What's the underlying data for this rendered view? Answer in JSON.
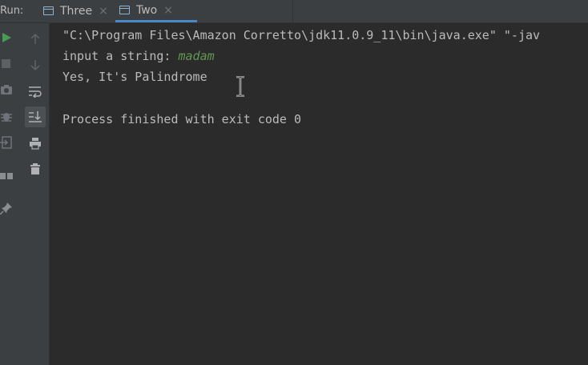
{
  "run_panel": {
    "label": "Run:",
    "tabs": [
      {
        "label": "Three",
        "close": "×",
        "active": false
      },
      {
        "label": "Two",
        "close": "×",
        "active": true
      }
    ]
  },
  "toolbar": {
    "outer": [
      {
        "icon": "rerun-icon",
        "color": "#499c54"
      },
      {
        "icon": "stop-icon"
      },
      {
        "icon": "camera-icon"
      },
      {
        "icon": "bug-icon"
      },
      {
        "icon": "exit-icon"
      },
      {
        "icon": "layout-icon"
      },
      {
        "icon": "pin-icon"
      }
    ],
    "inner": [
      {
        "icon": "up-arrow-icon"
      },
      {
        "icon": "down-arrow-icon"
      },
      {
        "icon": "soft-wrap-icon"
      },
      {
        "icon": "scroll-to-end-icon",
        "active": true
      },
      {
        "icon": "print-icon"
      },
      {
        "icon": "trash-icon"
      }
    ]
  },
  "console": {
    "command_line": "\"C:\\Program Files\\Amazon Corretto\\jdk11.0.9_11\\bin\\java.exe\" \"-jav",
    "prompt": "input a string: ",
    "user_input": "madam",
    "result": "Yes, It's Palindrome",
    "exit_message": "Process finished with exit code 0"
  },
  "colors": {
    "background": "#2b2b2b",
    "panel": "#3c3f41",
    "text": "#bbbbbb",
    "user_input": "#629755",
    "accent": "#4a88c7",
    "run_green": "#499c54"
  }
}
